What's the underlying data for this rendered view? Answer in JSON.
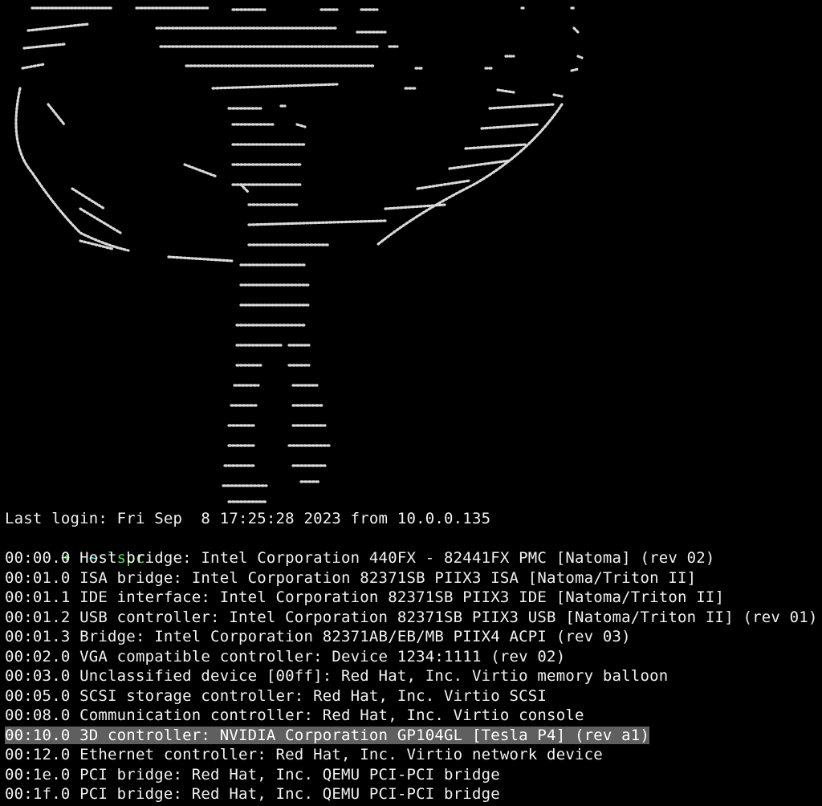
{
  "colors": {
    "background": "#000000",
    "text": "#f2f2f2",
    "prompt_green": "#5fd75f",
    "prompt_cyan": "#5fd7d7",
    "selection": "#5f5f5f"
  },
  "terminal": {
    "last_login": "Last login: Fri Sep  8 17:25:28 2023 from 10.0.0.135",
    "prompt": {
      "arrow": "➜",
      "dir": "~",
      "command": "lspci"
    },
    "output": [
      "00:00.0 Host bridge: Intel Corporation 440FX - 82441FX PMC [Natoma] (rev 02)",
      "00:01.0 ISA bridge: Intel Corporation 82371SB PIIX3 ISA [Natoma/Triton II]",
      "00:01.1 IDE interface: Intel Corporation 82371SB PIIX3 IDE [Natoma/Triton II]",
      "00:01.2 USB controller: Intel Corporation 82371SB PIIX3 USB [Natoma/Triton II] (rev 01)",
      "00:01.3 Bridge: Intel Corporation 82371AB/EB/MB PIIX4 ACPI (rev 03)",
      "00:02.0 VGA compatible controller: Device 1234:1111 (rev 02)",
      "00:03.0 Unclassified device [00ff]: Red Hat, Inc. Virtio memory balloon",
      "00:05.0 SCSI storage controller: Red Hat, Inc. Virtio SCSI",
      "00:08.0 Communication controller: Red Hat, Inc. Virtio console",
      "00:10.0 3D controller: NVIDIA Corporation GP104GL [Tesla P4] (rev a1)",
      "00:12.0 Ethernet controller: Red Hat, Inc. Virtio network device",
      "00:1e.0 PCI bridge: Red Hat, Inc. QEMU PCI-PCI bridge",
      "00:1f.0 PCI bridge: Red Hat, Inc. QEMU PCI-PCI bridge"
    ],
    "selected_index": 9
  }
}
